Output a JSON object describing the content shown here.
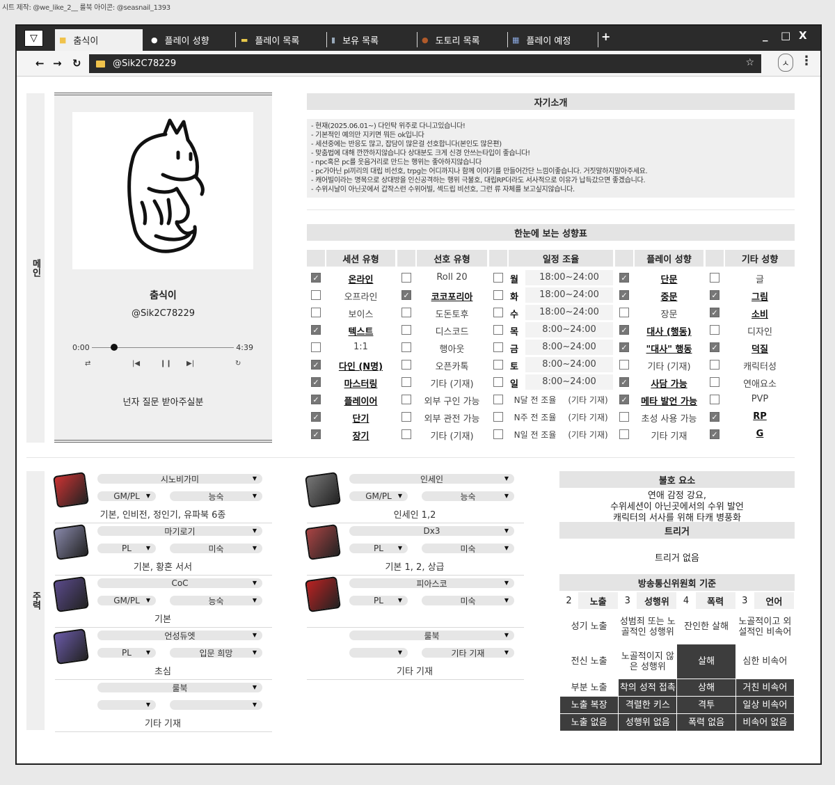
{
  "credit": "시트 제작: @we_like_2__    룰북 아이콘: @seasnail_1393",
  "tabs": [
    {
      "icon": "folder-icon",
      "label": "춤식이",
      "color": "#f0c24b"
    },
    {
      "icon": "speech-bubble-icon",
      "label": "플레이 성향",
      "color": "#ffffff"
    },
    {
      "icon": "ticket-icon",
      "label": "플레이 목록",
      "color": "#e8c84a"
    },
    {
      "icon": "books-icon",
      "label": "보유 목록",
      "color": "#9ab"
    },
    {
      "icon": "acorn-icon",
      "label": "도토리 목록",
      "color": "#b05a2a"
    },
    {
      "icon": "calendar-icon",
      "label": "플레이 예정",
      "color": "#8aa8e0"
    }
  ],
  "window": {
    "new_tab": "+",
    "minimize": "_",
    "maximize": "□",
    "close": "X"
  },
  "nav": {
    "back": "←",
    "forward": "→",
    "reload": "↻",
    "url": "@Sik2C78229"
  },
  "sections": {
    "main": "메인",
    "main_activity": "주력"
  },
  "profile": {
    "name": "춤식이",
    "handle": "@Sik2C78229",
    "time_start": "0:00",
    "time_end": "4:39",
    "progress": 0.13,
    "quote": "넌자 질문 받아주실분"
  },
  "intro": {
    "title": "자기소개",
    "lines": [
      "- 현재(2025.06.01~) 다인탁 위주로 다니고있습니다!",
      "- 기본적인 예의만 지키면 뭐든 ok입니다",
      "- 세션중에는 반응도 많고, 잡담이 많은걸 선호합니다(본인도 많은편)",
      "- 맞춤법에 대해 깐깐하지않습니다 상대분도 크게 신경 안쓰는타입이 좋습니다!",
      "- npc혹은 pc를 웃음거리로 만드는 행위는 좋아하지않습니다",
      "- pc가아닌 pl끼리의 대립 비선호, trpg는 어디까지나 함께 이야기를 만들어간단 느낌이좋습니다. 거짓말하지말아주세요.",
      "- 캐어빌이라는 명목으로 상대방을 인신공격하는 행위 극불호, 대립RP더라도 서사적으로 이유가 납득갔으면 좋겠습니다.",
      "- 수위시날이 아닌곳에서 갑작스런 수위어빌, 섹드립 비선호, 그런 류 자체를 보고싶지않습니다."
    ]
  },
  "chart": {
    "title": "한눈에 보는 성향표",
    "session_type": {
      "header": "세션 유형",
      "items": [
        {
          "label": "온라인",
          "checked": true
        },
        {
          "label": "오프라인",
          "checked": false
        },
        {
          "label": "보이스",
          "checked": false
        },
        {
          "label": "텍스트",
          "checked": true
        },
        {
          "label": "1:1",
          "checked": false
        },
        {
          "label": "다인 (N명)",
          "checked": true
        },
        {
          "label": "마스터링",
          "checked": true
        },
        {
          "label": "플레이어",
          "checked": true
        },
        {
          "label": "단기",
          "checked": true
        },
        {
          "label": "장기",
          "checked": true
        }
      ]
    },
    "pref_type": {
      "header": "선호 유형",
      "items": [
        {
          "label": "Roll 20",
          "checked": false
        },
        {
          "label": "코코포리아",
          "checked": true
        },
        {
          "label": "도돈토후",
          "checked": false
        },
        {
          "label": "디스코드",
          "checked": false
        },
        {
          "label": "행아웃",
          "checked": false
        },
        {
          "label": "오픈카톡",
          "checked": false
        },
        {
          "label": "기타 (기재)",
          "checked": false
        },
        {
          "label": "외부 구인 가능",
          "checked": false
        },
        {
          "label": "외부 관전 가능",
          "checked": false
        },
        {
          "label": "기타 (기재)",
          "checked": false
        }
      ]
    },
    "schedule": {
      "header": "일정 조율",
      "items": [
        {
          "day": "월",
          "time": "18:00~24:00",
          "checked": false
        },
        {
          "day": "화",
          "time": "18:00~24:00",
          "checked": false
        },
        {
          "day": "수",
          "time": "18:00~24:00",
          "checked": false
        },
        {
          "day": "목",
          "time": "8:00~24:00",
          "checked": false
        },
        {
          "day": "금",
          "time": "8:00~24:00",
          "checked": false
        },
        {
          "day": "토",
          "time": "8:00~24:00",
          "checked": false
        },
        {
          "day": "일",
          "time": "8:00~24:00",
          "checked": false
        },
        {
          "day": "N달 전 조율",
          "time": "(기타 기재)",
          "checked": false
        },
        {
          "day": "N주 전 조율",
          "time": "(기타 기재)",
          "checked": false
        },
        {
          "day": "N일 전 조율",
          "time": "(기타 기재)",
          "checked": false
        }
      ]
    },
    "play_style": {
      "header": "플레이 성향",
      "items": [
        {
          "label": "단문",
          "checked": true
        },
        {
          "label": "중문",
          "checked": true
        },
        {
          "label": "장문",
          "checked": false
        },
        {
          "label": "대사 (행동)",
          "checked": true
        },
        {
          "label": "\"대사\" 행동",
          "checked": true
        },
        {
          "label": "기타 (기재)",
          "checked": false
        },
        {
          "label": "사담 가능",
          "checked": true
        },
        {
          "label": "메타 발언 가능",
          "checked": true
        },
        {
          "label": "초성 사용 가능",
          "checked": false
        },
        {
          "label": "기타 기재",
          "checked": false
        }
      ]
    },
    "etc_style": {
      "header": "기타 성향",
      "items": [
        {
          "label": "글",
          "checked": false
        },
        {
          "label": "그림",
          "checked": true
        },
        {
          "label": "소비",
          "checked": true
        },
        {
          "label": "디자인",
          "checked": false
        },
        {
          "label": "덕질",
          "checked": true
        },
        {
          "label": "캐릭터성",
          "checked": false
        },
        {
          "label": "연애요소",
          "checked": false
        },
        {
          "label": "PVP",
          "checked": false
        },
        {
          "label": "RP",
          "checked": true
        },
        {
          "label": "G",
          "checked": true
        }
      ]
    }
  },
  "games_left": [
    {
      "title": "시노비가미",
      "role": "GM/PL",
      "skill": "능숙",
      "desc": "기본, 인비전, 정인기, 유파북 6종",
      "book": "#c33"
    },
    {
      "title": "마기로기",
      "role": "PL",
      "skill": "미숙",
      "desc": "기본, 황혼 서서",
      "book": "#88a"
    },
    {
      "title": "CoC",
      "role": "GM/PL",
      "skill": "능숙",
      "desc": "기본",
      "book": "#5a4a8a"
    },
    {
      "title": "언성듀엣",
      "role": "PL",
      "skill": "입문 희망",
      "desc": "초심",
      "book": "#6a5aa8"
    },
    {
      "title": "룰북",
      "role": "",
      "skill": "",
      "desc": "기타 기재",
      "book": ""
    }
  ],
  "games_right": [
    {
      "title": "인세인",
      "role": "GM/PL",
      "skill": "능숙",
      "desc": "인세인 1,2",
      "book": "#777"
    },
    {
      "title": "Dx3",
      "role": "PL",
      "skill": "미숙",
      "desc": "기본 1, 2, 상급",
      "book": "#a44"
    },
    {
      "title": "피아스코",
      "role": "PL",
      "skill": "미숙",
      "desc": "",
      "book": "#b22"
    },
    {
      "title": "룰북",
      "role": "",
      "skill": "기타 기재",
      "desc": "기타 기재",
      "book": ""
    }
  ],
  "dislikes": {
    "title": "불호 요소",
    "lines": [
      "연애 감정 강요,",
      "수위세션이 아닌곳에서의 수위 발언",
      "캐릭터의 서사를 위해 타캐 병풍화"
    ]
  },
  "triggers": {
    "title": "트리거",
    "text": "트리거 없음"
  },
  "rating": {
    "title": "방송통신위원회 기준",
    "headers": [
      {
        "num": "2",
        "label": "노출"
      },
      {
        "num": "3",
        "label": "성행위"
      },
      {
        "num": "4",
        "label": "폭력"
      },
      {
        "num": "3",
        "label": "언어"
      }
    ],
    "rows": [
      [
        "성기 노출",
        "성범죄 또는 노골적인 성행위",
        "잔인한 살해",
        "노골적이고 외설적인 비속어"
      ],
      [
        "전신 노출",
        "노골적이지 않은 성행위",
        "살해",
        "심한 비속어"
      ],
      [
        "부분 노출",
        "착의 성적 접촉",
        "상해",
        "거친 비속어"
      ],
      [
        "노출 복장",
        "격렬한 키스",
        "격투",
        "일상 비속어"
      ],
      [
        "노출 없음",
        "성행위 없음",
        "폭력 없음",
        "비속어 없음"
      ]
    ]
  }
}
